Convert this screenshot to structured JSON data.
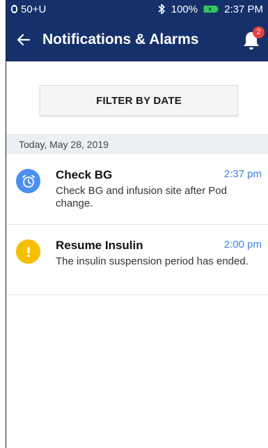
{
  "status_bar": {
    "carrier": "50+U",
    "battery": "100%",
    "time": "2:37 PM",
    "icons": [
      "signal-icon",
      "bluetooth-icon",
      "battery-icon"
    ]
  },
  "app_bar": {
    "title": "Notifications & Alarms",
    "back_icon": "arrow-left-icon",
    "bell_icon": "bell-icon",
    "badge_count": "2"
  },
  "filter": {
    "label": "FILTER BY DATE"
  },
  "date_header": "Today, May 28, 2019",
  "notifications": [
    {
      "icon": "alarm-clock-icon",
      "icon_color": "#4b8ff0",
      "title": "Check BG",
      "time": "2:37 pm",
      "body": "Check BG and infusion site after Pod change."
    },
    {
      "icon": "exclamation-icon",
      "icon_color": "#f5c000",
      "title": "Resume Insulin",
      "time": "2:00 pm",
      "body": "The insulin suspension period has ended."
    }
  ],
  "colors": {
    "header_bg": "#16306a",
    "badge": "#e8413a",
    "time_text": "#3f7fe0",
    "battery_fill": "#34c759"
  }
}
